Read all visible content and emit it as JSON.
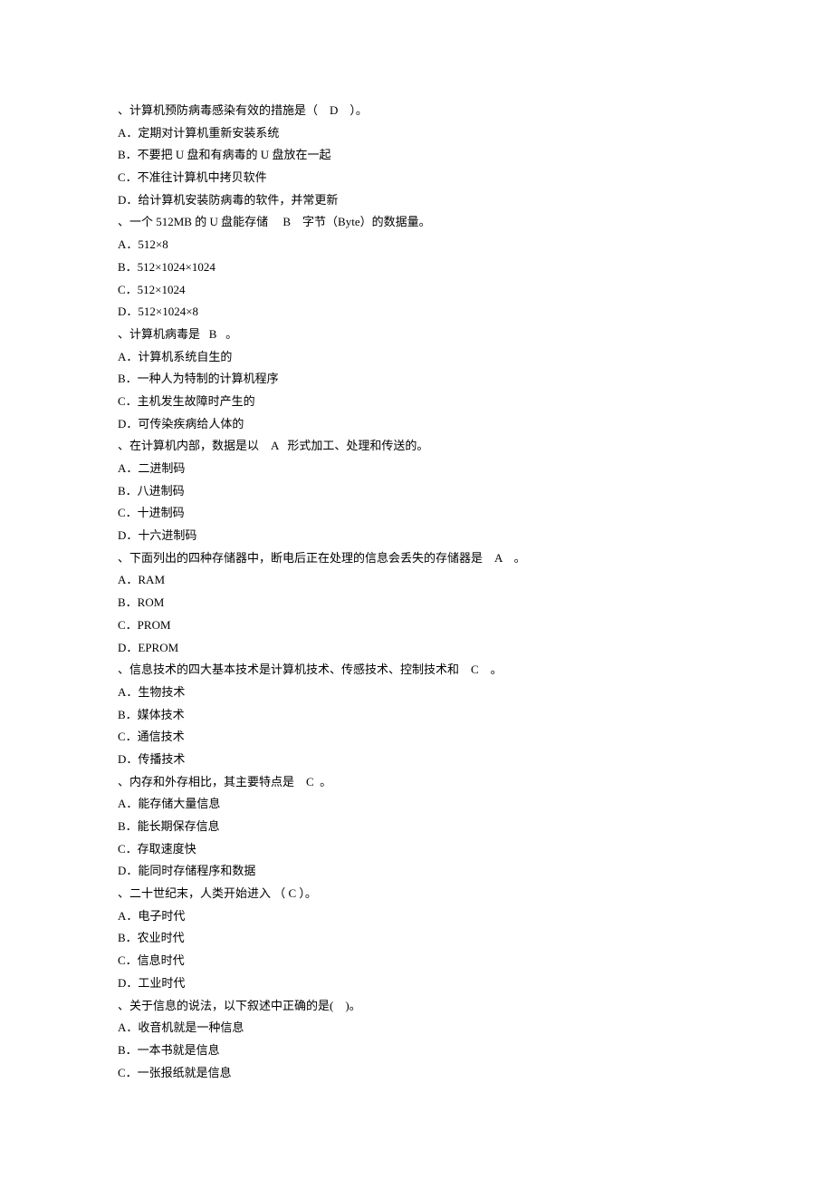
{
  "questions": [
    {
      "stem": "、计算机预防病毒感染有效的措施是（    D    ）。",
      "options": [
        "A．定期对计算机重新安装系统",
        "B．不要把 U 盘和有病毒的 U 盘放在一起",
        "C．不准往计算机中拷贝软件",
        "D．给计算机安装防病毒的软件，并常更新"
      ]
    },
    {
      "stem": "、一个 512MB 的 U 盘能存储     B    字节（Byte）的数据量。",
      "options": [
        "A．512×8",
        "B．512×1024×1024",
        "C．512×1024",
        "D．512×1024×8"
      ]
    },
    {
      "stem": "、计算机病毒是   B   。",
      "options": [
        "A．计算机系统自生的",
        "B．一种人为特制的计算机程序",
        "C．主机发生故障时产生的",
        "D．可传染疾病给人体的"
      ]
    },
    {
      "stem": "、在计算机内部，数据是以    A   形式加工、处理和传送的。",
      "options": [
        "A．二进制码",
        "B．八进制码",
        "C．十进制码",
        "D．十六进制码"
      ]
    },
    {
      "stem": "、下面列出的四种存储器中，断电后正在处理的信息会丢失的存储器是    A    。",
      "options": [
        "A．RAM",
        "B．ROM",
        "C．PROM",
        "D．EPROM"
      ]
    },
    {
      "stem": "、信息技术的四大基本技术是计算机技术、传感技术、控制技术和    C    。",
      "options": [
        "A．生物技术",
        "B．媒体技术",
        "C．通信技术",
        "D．传播技术"
      ]
    },
    {
      "stem": "、内存和外存相比，其主要特点是    C  。",
      "options": [
        "A．能存储大量信息",
        "B．能长期保存信息",
        "C．存取速度快",
        "D．能同时存储程序和数据"
      ]
    },
    {
      "stem": "、二十世纪末，人类开始进入 （ C ）。",
      "options": [
        "A．电子时代",
        "B．农业时代",
        "C．信息时代",
        "D．工业时代"
      ]
    },
    {
      "stem": "、关于信息的说法，以下叙述中正确的是(    )。",
      "options": [
        "A．收音机就是一种信息",
        "B．一本书就是信息",
        "C．一张报纸就是信息"
      ]
    }
  ]
}
